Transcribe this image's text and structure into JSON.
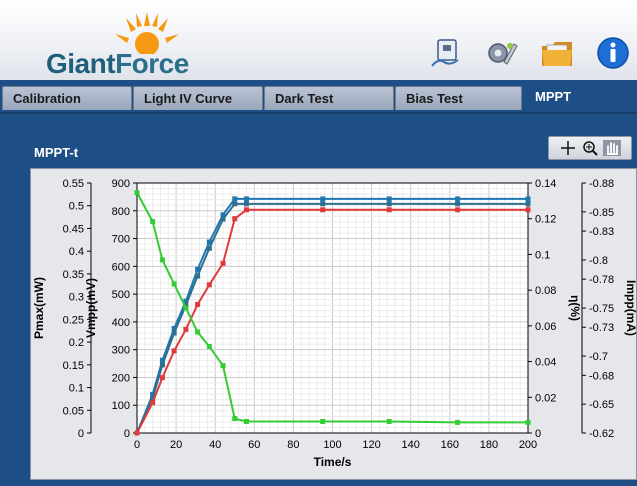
{
  "header": {
    "logo_text_a": "Giant",
    "logo_text_b": "Force",
    "icons": [
      "device-icon",
      "settings-wrench-icon",
      "folder-icon",
      "info-icon"
    ]
  },
  "tabs": [
    {
      "label": "Calibration",
      "active": false
    },
    {
      "label": "Light IV Curve",
      "active": false
    },
    {
      "label": "Dark Test",
      "active": false
    },
    {
      "label": "Bias Test",
      "active": false
    },
    {
      "label": "MPPT",
      "active": true
    }
  ],
  "chart_title": "MPPT-t",
  "colors": {
    "background": "#1d4f86",
    "pmax": "#1f77b4",
    "vmpp": "#2e6f8e",
    "eta": "#e03a3a",
    "impp": "#33cc33"
  },
  "chart_data": {
    "type": "line",
    "xlabel": "Time/s",
    "xlim": [
      0,
      200
    ],
    "xticks": [
      0,
      20,
      40,
      60,
      80,
      100,
      120,
      140,
      160,
      180,
      200
    ],
    "axes": {
      "pmax": {
        "label": "Pmax(mW)",
        "lim": [
          0,
          0.55
        ],
        "ticks": [
          "0",
          "0.05",
          "0.1",
          "0.15",
          "0.2",
          "0.25",
          "0.3",
          "0.35",
          "0.4",
          "0.45",
          "0.5",
          "0.55"
        ]
      },
      "vmpp": {
        "label": "Vmpp(mV)",
        "lim": [
          0,
          900
        ],
        "ticks": [
          "0",
          "100",
          "200",
          "300",
          "400",
          "500",
          "600",
          "700",
          "800",
          "900"
        ]
      },
      "eta": {
        "label": "η(%)",
        "lim": [
          0,
          0.14
        ],
        "ticks": [
          "0",
          "0.02",
          "0.04",
          "0.06",
          "0.08",
          "0.1",
          "0.12",
          "0.14"
        ]
      },
      "impp": {
        "label": "Impp(mA)",
        "lim": [
          -0.62,
          -0.88
        ],
        "ticks": [
          "-0.62",
          "-0.65",
          "-0.68",
          "-0.7",
          "-0.73",
          "-0.75",
          "-0.78",
          "-0.8",
          "-0.83",
          "-0.85",
          "-0.88"
        ]
      }
    },
    "series": [
      {
        "axis": "pmax",
        "color": "#1f77b4",
        "x": [
          0,
          8,
          13,
          19,
          25,
          31,
          37,
          44,
          50,
          56,
          95,
          129,
          164,
          200
        ],
        "y": [
          0,
          0.085,
          0.16,
          0.23,
          0.29,
          0.36,
          0.42,
          0.48,
          0.515,
          0.515,
          0.515,
          0.515,
          0.515,
          0.515
        ]
      },
      {
        "axis": "vmpp",
        "color": "#2e6f8e",
        "x": [
          0,
          8,
          13,
          19,
          25,
          31,
          37,
          44,
          50,
          56,
          95,
          129,
          164,
          200
        ],
        "y": [
          0,
          125,
          245,
          360,
          460,
          565,
          665,
          770,
          825,
          825,
          825,
          825,
          825,
          825
        ]
      },
      {
        "axis": "eta",
        "color": "#e03a3a",
        "x": [
          0,
          8,
          13,
          19,
          25,
          31,
          37,
          44,
          50,
          56,
          95,
          129,
          164,
          200
        ],
        "y": [
          0,
          0.017,
          0.031,
          0.046,
          0.058,
          0.072,
          0.083,
          0.095,
          0.12,
          0.125,
          0.125,
          0.125,
          0.125,
          0.125
        ]
      },
      {
        "axis": "impp",
        "color": "#33cc33",
        "x": [
          0,
          8,
          13,
          19,
          25,
          31,
          37,
          44,
          50,
          56,
          95,
          129,
          164,
          200
        ],
        "y": [
          -0.87,
          -0.84,
          -0.8,
          -0.775,
          -0.75,
          -0.725,
          -0.71,
          -0.69,
          -0.635,
          -0.632,
          -0.632,
          -0.632,
          -0.631,
          -0.631
        ]
      }
    ]
  }
}
